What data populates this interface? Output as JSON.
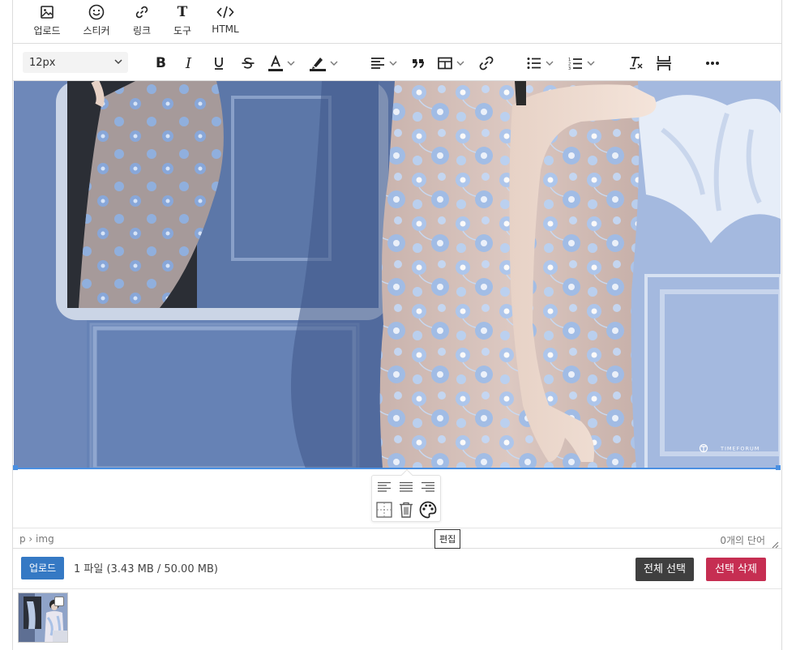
{
  "top_tools": [
    {
      "label": "업로드",
      "icon": "image-icon"
    },
    {
      "label": "스티커",
      "icon": "smiley-icon"
    },
    {
      "label": "링크",
      "icon": "link-icon"
    },
    {
      "label": "도구",
      "icon": "text-tool-icon"
    },
    {
      "label": "HTML",
      "icon": "code-icon"
    }
  ],
  "toolbar": {
    "font_size": "12px"
  },
  "image": {
    "watermark": "TIMEFORUM"
  },
  "popup": {
    "tooltip": "편집"
  },
  "status": {
    "path": "p › img",
    "word_count": "0개의 단어"
  },
  "upload": {
    "button_label": "업로드",
    "file_info": "1 파일 (3.43 MB / 50.00 MB)",
    "select_all_label": "전체 선택",
    "delete_selected_label": "선택 삭제"
  },
  "colors": {
    "accent": "#3579c4",
    "danger": "#c62e52",
    "dark": "#3f3f3f",
    "selection": "#4a90e2"
  }
}
